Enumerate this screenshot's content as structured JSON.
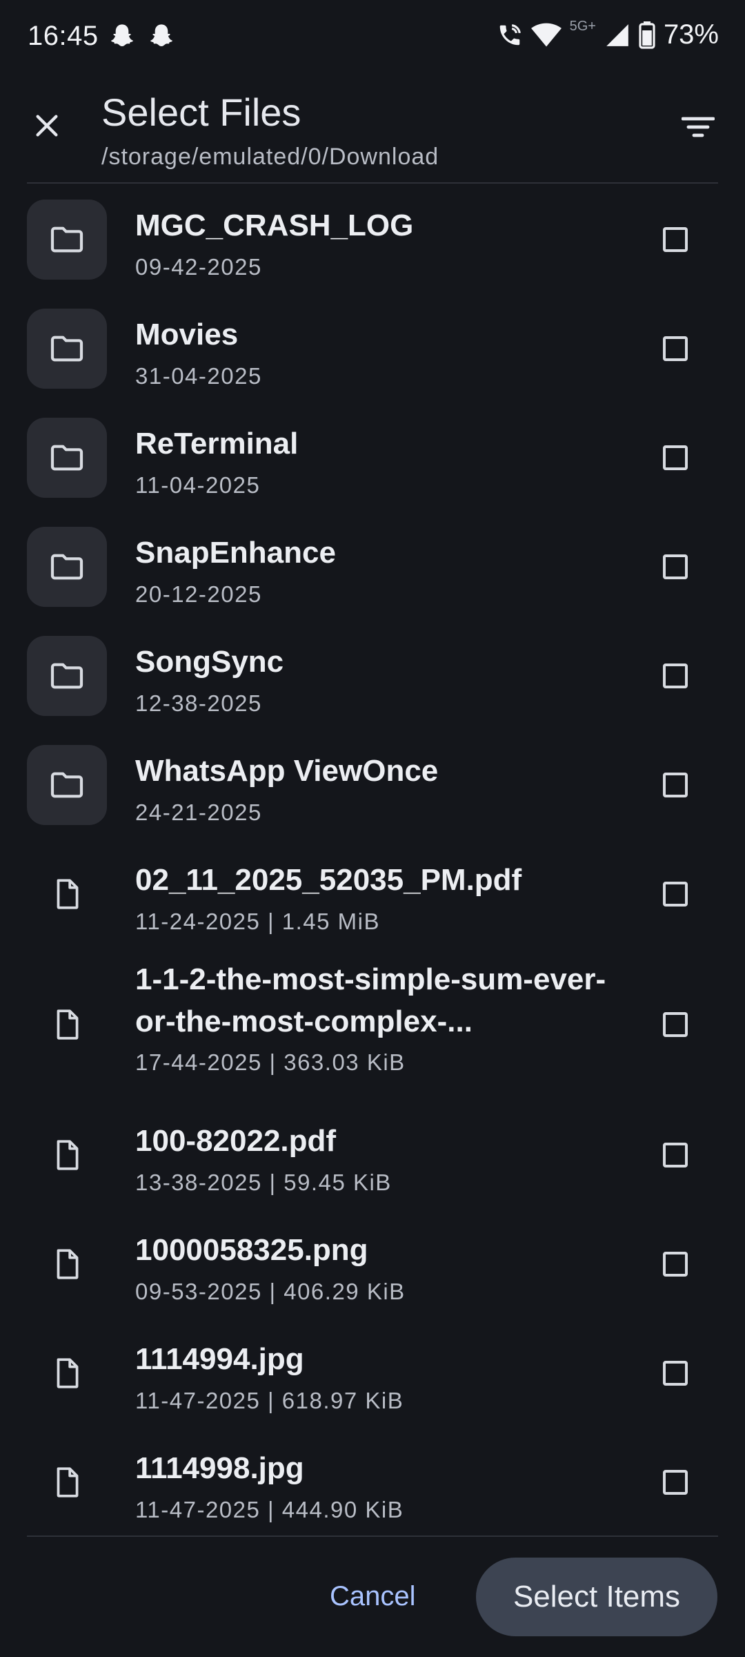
{
  "status_bar": {
    "time": "16:45",
    "network_label": "5G+",
    "battery": "73%",
    "icons": [
      "snapchat-ghost-icon",
      "snapchat-ghost-icon",
      "wifi-calling-icon",
      "wifi-icon",
      "signal-icon",
      "battery-icon"
    ]
  },
  "header": {
    "title": "Select Files",
    "path": "/storage/emulated/0/Download"
  },
  "items": [
    {
      "type": "folder",
      "name": "MGC_CRASH_LOG",
      "meta": "09-42-2025"
    },
    {
      "type": "folder",
      "name": "Movies",
      "meta": "31-04-2025"
    },
    {
      "type": "folder",
      "name": "ReTerminal",
      "meta": "11-04-2025"
    },
    {
      "type": "folder",
      "name": "SnapEnhance",
      "meta": "20-12-2025"
    },
    {
      "type": "folder",
      "name": "SongSync",
      "meta": "12-38-2025"
    },
    {
      "type": "folder",
      "name": "WhatsApp ViewOnce",
      "meta": "24-21-2025"
    },
    {
      "type": "file",
      "name": "02_11_2025_52035_PM.pdf",
      "meta": "11-24-2025 | 1.45 MiB"
    },
    {
      "type": "file",
      "name": "1-1-2-the-most-simple-sum-ever-or-the-most-complex-...",
      "meta": "17-44-2025 | 363.03 KiB"
    },
    {
      "type": "file",
      "name": "100-82022.pdf",
      "meta": "13-38-2025 | 59.45 KiB"
    },
    {
      "type": "file",
      "name": "1000058325.png",
      "meta": "09-53-2025 | 406.29 KiB"
    },
    {
      "type": "file",
      "name": "1114994.jpg",
      "meta": "11-47-2025 | 618.97 KiB"
    },
    {
      "type": "file",
      "name": "1114998.jpg",
      "meta": "11-47-2025 | 444.90 KiB"
    }
  ],
  "footer": {
    "cancel_label": "Cancel",
    "select_label": "Select Items"
  },
  "colors": {
    "background": "#14161b",
    "accent": "#a9c3ff",
    "button_bg": "#3d4452"
  }
}
